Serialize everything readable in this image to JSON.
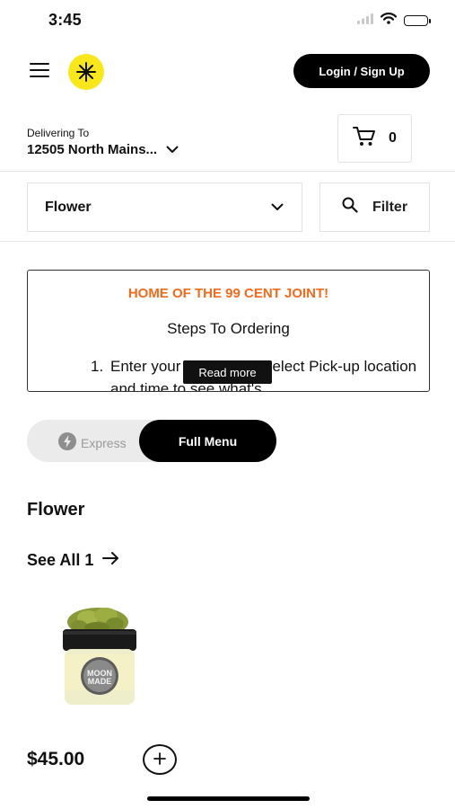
{
  "status_bar": {
    "time": "3:45"
  },
  "header": {
    "menu_icon": "hamburger-icon",
    "logo_icon": "sparkle-logo-icon",
    "login_label": "Login / Sign Up",
    "brand_color": "#f8e71c"
  },
  "delivery": {
    "label": "Delivering To",
    "address": "12505 North Mains..."
  },
  "cart": {
    "count": "0"
  },
  "category": {
    "selected": "Flower"
  },
  "filter": {
    "label": "Filter"
  },
  "announcement": {
    "title": "HOME OF THE 99 CENT JOINT!",
    "subtitle": "Steps To Ordering",
    "step_number": "1.",
    "step_text": "Enter your Address or Select Pick-up location and time to see what's",
    "read_more": "Read more",
    "title_color": "#f26a1b"
  },
  "toggle": {
    "express": "Express",
    "full_menu": "Full Menu"
  },
  "section": {
    "title": "Flower",
    "see_all": "See All 1"
  },
  "product": {
    "price": "$45.00",
    "brand_text": "MOON MADE"
  }
}
